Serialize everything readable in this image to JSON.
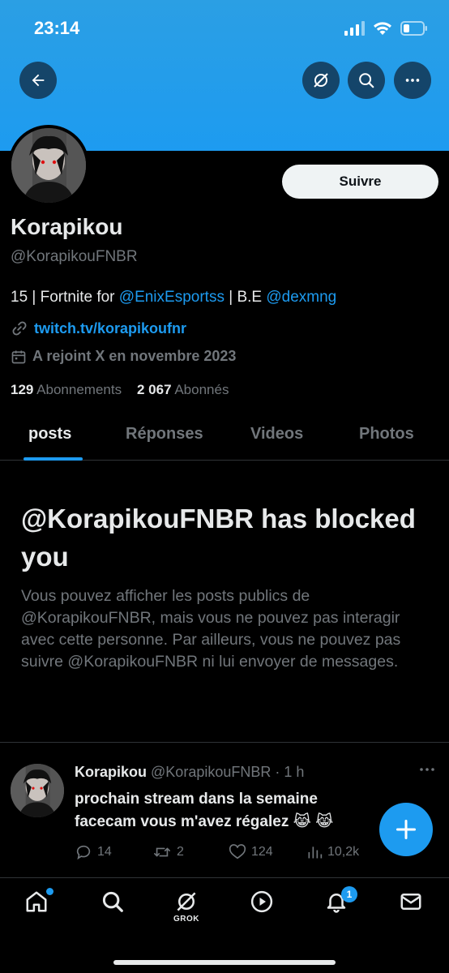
{
  "status_bar": {
    "time": "23:14"
  },
  "profile": {
    "display_name": "Korapikou",
    "handle": "@KorapikouFNBR",
    "follow_label": "Suivre",
    "bio": {
      "prefix": "15 | Fortnite for ",
      "mention1": "@EnixEsportss",
      "middle": " | B.E ",
      "mention2": "@dexmng"
    },
    "website": "twitch.tv/korapikoufnr",
    "joined": "A rejoint X en novembre 2023",
    "following_count": "129",
    "following_label": "Abonnements",
    "followers_count": "2 067",
    "followers_label": "Abonnés"
  },
  "tabs": [
    {
      "label": "posts",
      "active": true
    },
    {
      "label": "Réponses",
      "active": false
    },
    {
      "label": "Videos",
      "active": false
    },
    {
      "label": "Photos",
      "active": false
    }
  ],
  "blocked": {
    "title": "@KorapikouFNBR has blocked you",
    "body": "Vous pouvez afficher les posts publics de @KorapikouFNBR, mais vous ne pouvez pas interagir avec cette personne. Par ailleurs, vous ne pouvez pas suivre @KorapikouFNBR ni lui envoyer de messages."
  },
  "tweet": {
    "name": "Korapikou",
    "handle_time": "@KorapikouFNBR · 1 h",
    "text_line1": "prochain stream dans la semaine",
    "text_line2": "facecam vous m'avez régalez 😹 😹",
    "replies": "14",
    "retweets": "2",
    "likes": "124",
    "views": "10,2k"
  },
  "bottom_nav": {
    "grok_label": "GROK",
    "notifications_badge": "1"
  },
  "colors": {
    "accent": "#1d9bf0",
    "banner": "#1d9bf0",
    "background": "#000000",
    "text_primary": "#e7e9ea",
    "text_secondary": "#71767b"
  },
  "icons": [
    "back-arrow-icon",
    "grok-icon",
    "search-icon",
    "more-icon",
    "link-icon",
    "calendar-icon",
    "reply-icon",
    "retweet-icon",
    "like-icon",
    "views-icon",
    "compose-plus-icon",
    "home-icon",
    "play-icon",
    "bell-icon",
    "mail-icon",
    "signal-icon",
    "wifi-icon",
    "battery-icon"
  ]
}
